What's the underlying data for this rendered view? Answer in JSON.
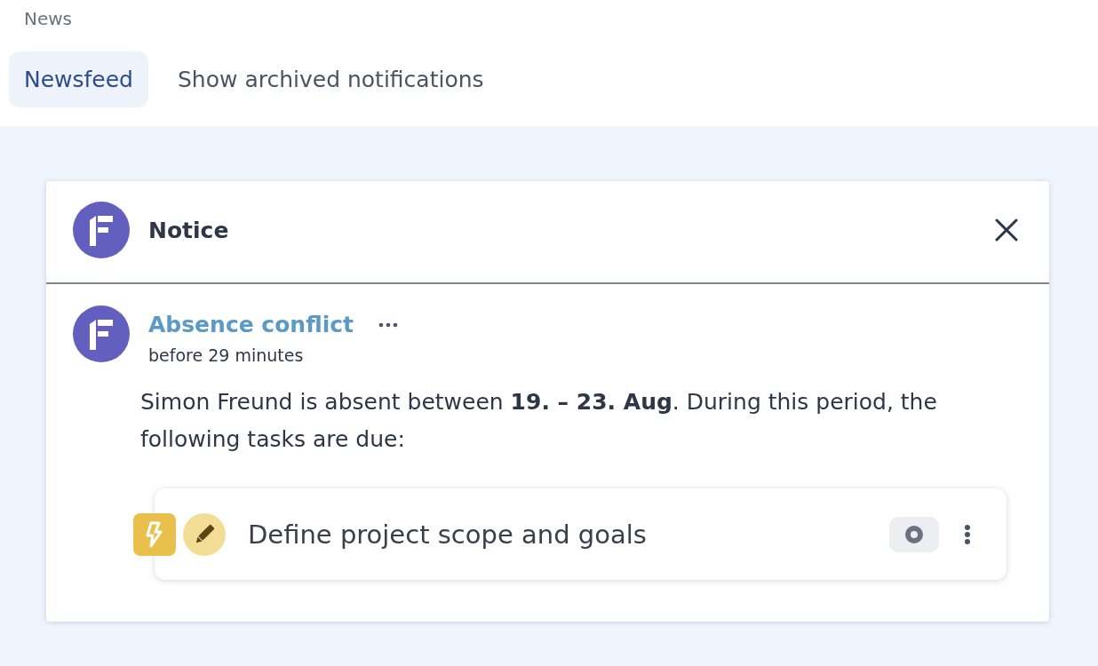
{
  "page": {
    "title": "News"
  },
  "tabs": [
    {
      "label": "Newsfeed",
      "selected": true
    },
    {
      "label": "Show archived notifications",
      "selected": false
    }
  ],
  "notice": {
    "title": "Notice",
    "notification": {
      "title": "Absence conflict",
      "time": "before 29 minutes",
      "message": "Simon Freund is absent between **19. – 23. Aug**. During this period, the following tasks are due:",
      "tasks": [
        {
          "title": "Define project scope and goals"
        }
      ]
    }
  }
}
